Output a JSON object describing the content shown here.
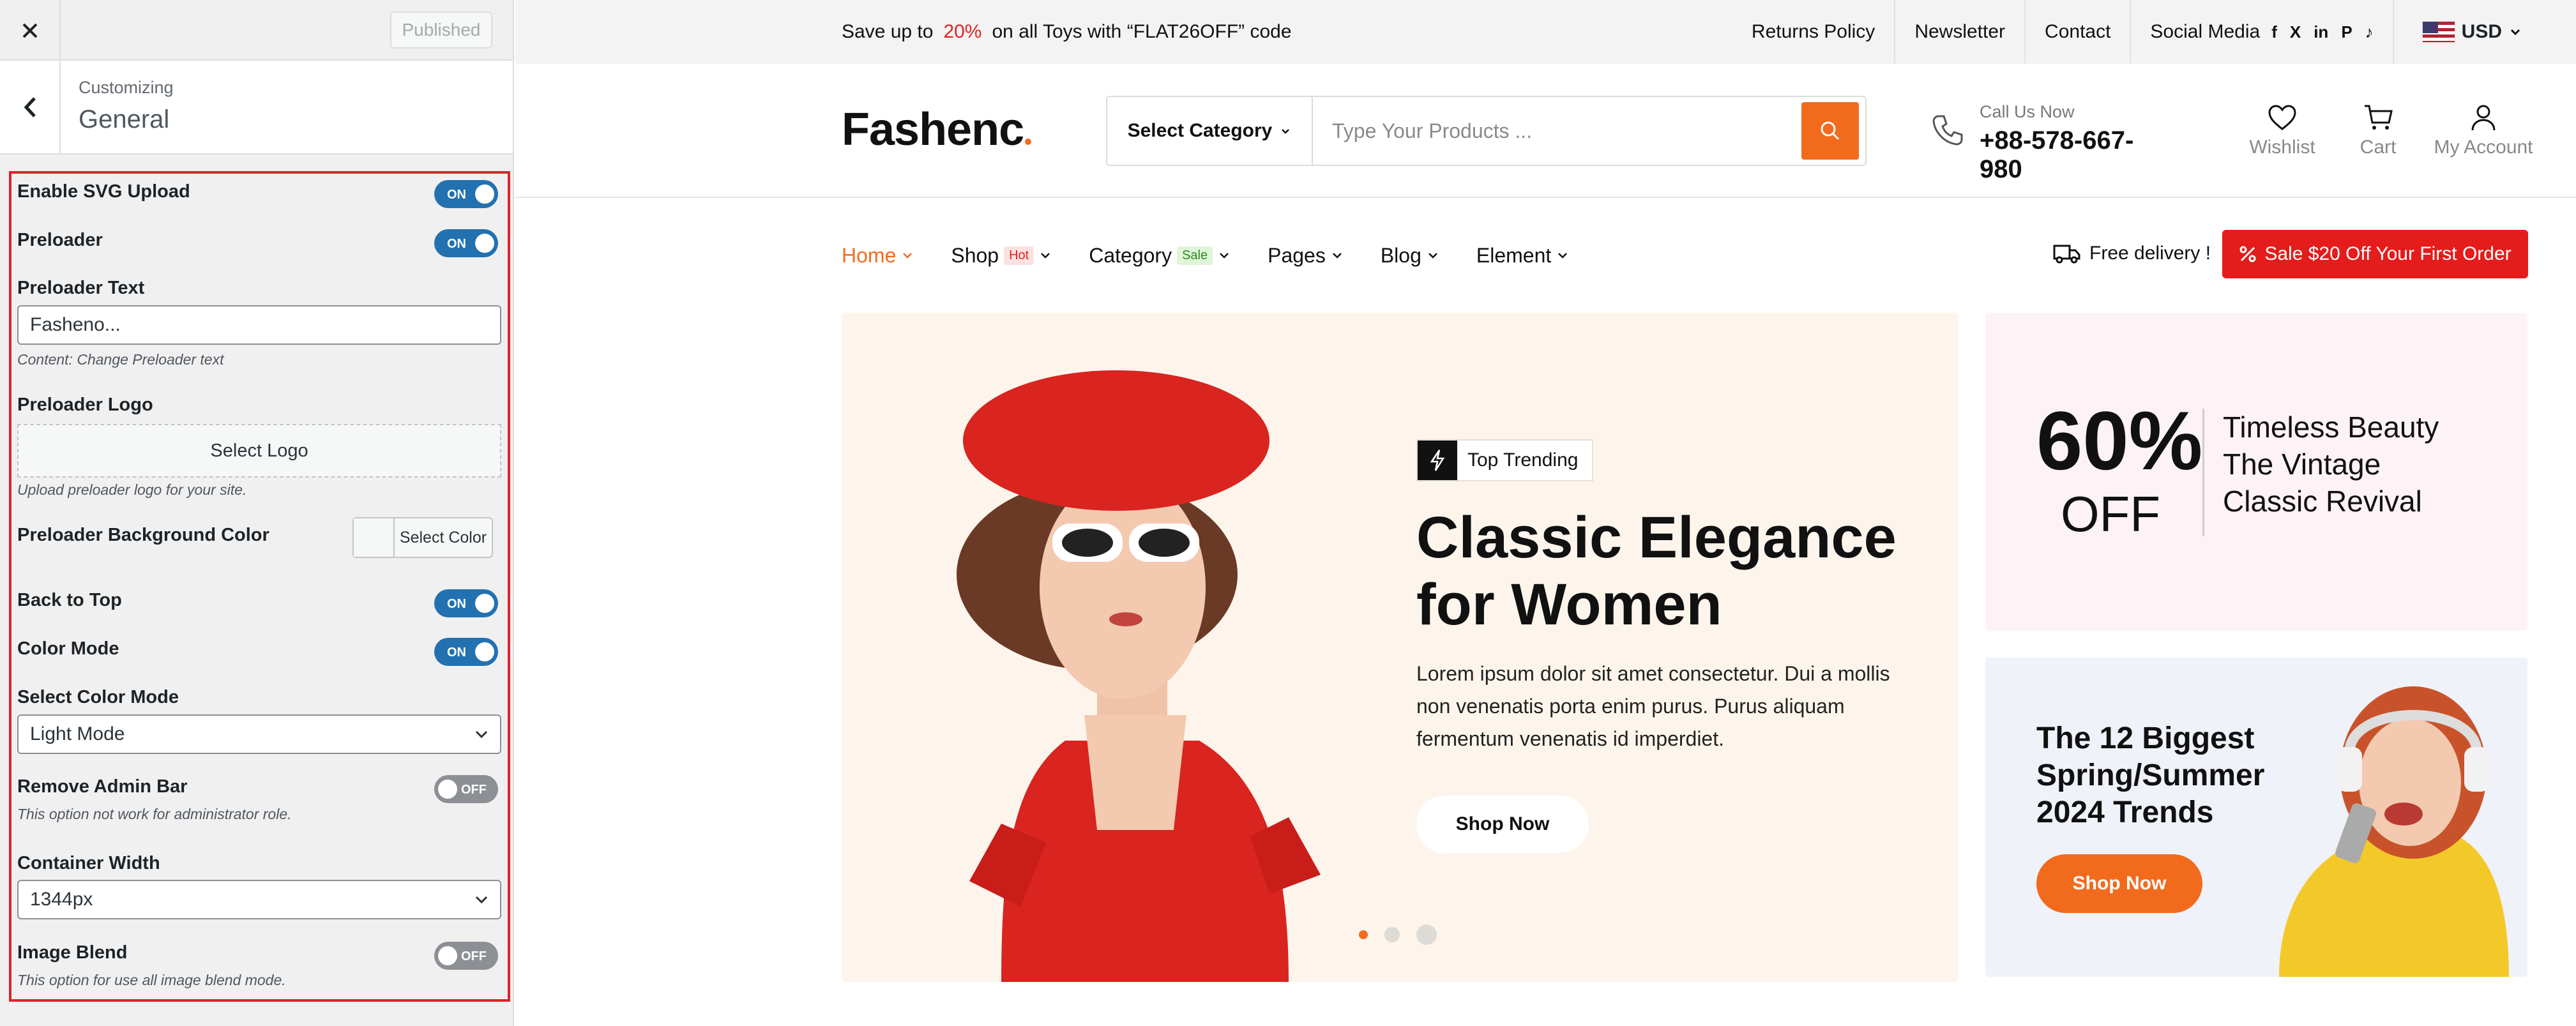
{
  "customizer": {
    "published_label": "Published",
    "section_small": "Customizing",
    "section_title": "General",
    "options": {
      "svg_upload": {
        "label": "Enable SVG Upload",
        "state": "ON"
      },
      "preloader": {
        "label": "Preloader",
        "state": "ON"
      },
      "preloader_text": {
        "label": "Preloader Text",
        "value": "Fasheno...",
        "note": "Content: Change Preloader text"
      },
      "preloader_logo": {
        "label": "Preloader Logo",
        "button": "Select Logo",
        "note": "Upload preloader logo for your site."
      },
      "preloader_bg": {
        "label": "Preloader Background Color",
        "button": "Select Color"
      },
      "back_to_top": {
        "label": "Back to Top",
        "state": "ON"
      },
      "color_mode": {
        "label": "Color Mode",
        "state": "ON"
      },
      "select_color_mode": {
        "label": "Select Color Mode",
        "value": "Light Mode"
      },
      "remove_admin_bar": {
        "label": "Remove Admin Bar",
        "state": "OFF",
        "note": "This option not work for administrator role."
      },
      "container_width": {
        "label": "Container Width",
        "value": "1344px"
      },
      "image_blend": {
        "label": "Image Blend",
        "state": "OFF",
        "note": "This option for use all image blend mode."
      }
    }
  },
  "site": {
    "topbar": {
      "promo_before": "Save up to",
      "promo_pct": "20%",
      "promo_after": "on all Toys with “FLAT26OFF” code",
      "links": [
        "Returns Policy",
        "Newsletter",
        "Contact"
      ],
      "social_label": "Social Media",
      "social_icons": [
        "f",
        "X",
        "in",
        "P",
        "♪"
      ],
      "currency": "USD"
    },
    "header": {
      "logo": "Fashenc",
      "category_select": "Select Category",
      "search_placeholder": "Type Your Products ...",
      "call_label": "Call Us Now",
      "call_number": "+88-578-667-980",
      "wishlist": "Wishlist",
      "cart": "Cart",
      "account": "My Account"
    },
    "nav": {
      "items": [
        "Home",
        "Shop",
        "Category",
        "Pages",
        "Blog",
        "Element"
      ],
      "shop_badge": "Hot",
      "category_badge": "Sale",
      "free_delivery": "Free delivery !",
      "sale_button": "Sale $20 Off Your First Order"
    },
    "hero": {
      "tag": "Top Trending",
      "title": "Classic Elegance for Women",
      "desc": "Lorem ipsum dolor sit amet consectetur. Dui a mollis non venenatis porta enim purus. Purus aliquam fermentum venenatis id imperdiet.",
      "button": "Shop Now"
    },
    "banner1": {
      "percent": "60%",
      "off": "OFF",
      "text": "Timeless Beauty The Vintage Classic Revival"
    },
    "banner2": {
      "text": "The 12 Biggest Spring/Summer 2024 Trends",
      "button": "Shop Now"
    }
  },
  "colors": {
    "accent": "#f26b1d",
    "sale_red": "#e51c1c",
    "toggle_on": "#2271b1",
    "highlight_border": "#e0232a"
  }
}
